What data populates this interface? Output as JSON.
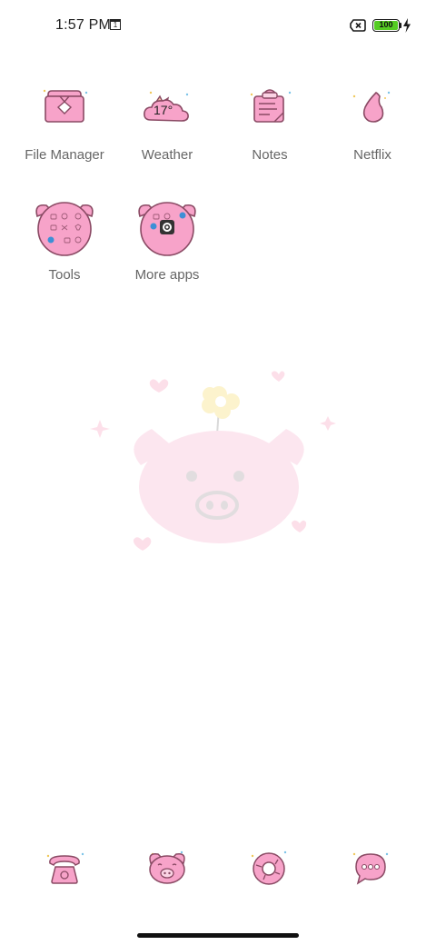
{
  "status_bar": {
    "time": "1:57 PM",
    "calendar_day": "1",
    "battery_level": "100",
    "icons": [
      "calendar-icon",
      "sim-off-icon",
      "battery-icon",
      "charging-icon"
    ]
  },
  "apps": [
    {
      "label": "File Manager",
      "icon": "folder-icon"
    },
    {
      "label": "Weather",
      "icon": "weather-cloud-icon",
      "temperature": "17°"
    },
    {
      "label": "Notes",
      "icon": "notes-icon"
    },
    {
      "label": "Netflix",
      "icon": "netflix-flame-icon"
    }
  ],
  "folders": [
    {
      "label": "Tools",
      "icon": "pig-folder-icon"
    },
    {
      "label": "More apps",
      "icon": "pig-folder-icon"
    }
  ],
  "dock": [
    {
      "name": "phone",
      "icon": "phone-icon"
    },
    {
      "name": "pig-face",
      "icon": "pig-face-icon"
    },
    {
      "name": "browser",
      "icon": "donut-icon"
    },
    {
      "name": "messages",
      "icon": "message-bubble-icon"
    }
  ],
  "colors": {
    "icon_pink": "#f7a3c9",
    "icon_outline": "#8a4a64",
    "label_gray": "#666666",
    "wallpaper_pink": "#fde6ee"
  }
}
